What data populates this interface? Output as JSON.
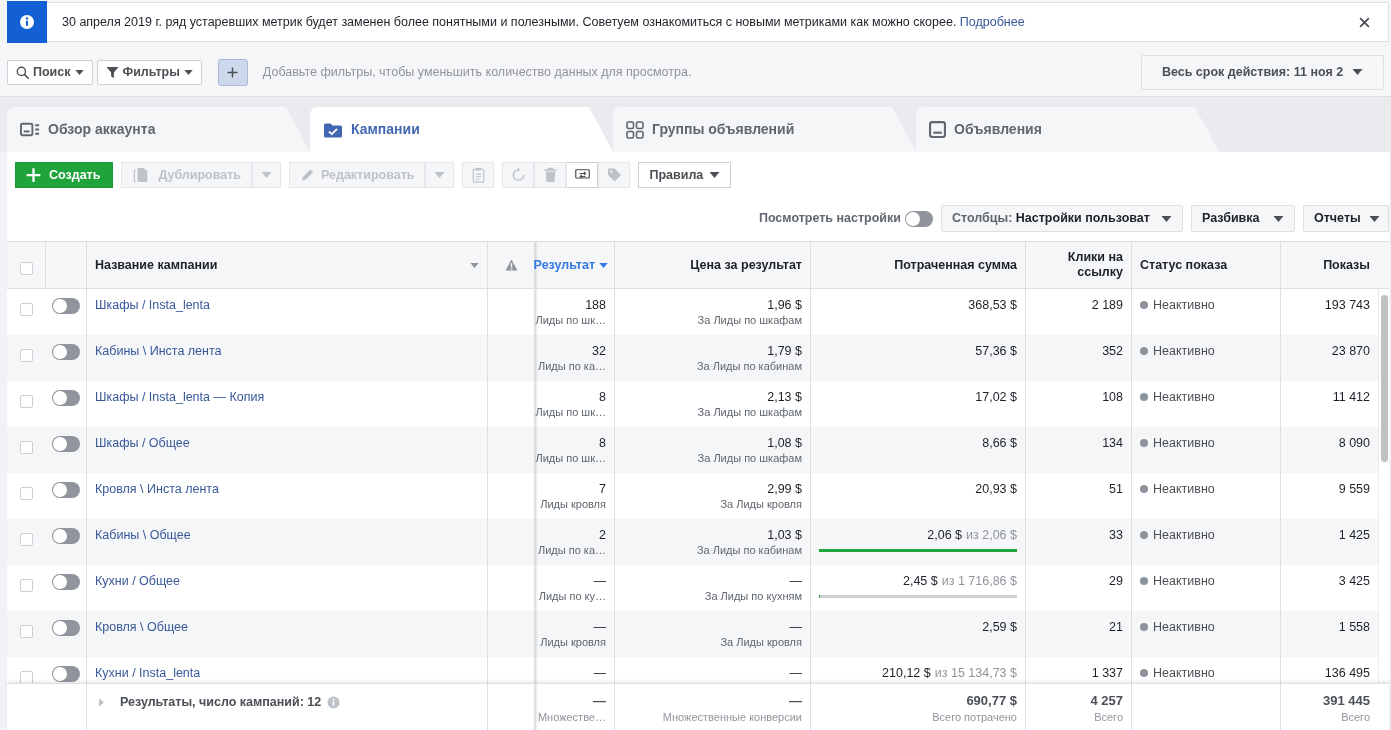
{
  "banner": {
    "text": "30 апреля 2019 г. ряд устаревших метрик будет заменен более понятными и полезными. Советуем ознакомиться с новыми метриками как можно скорее.",
    "link": "Подробнее"
  },
  "filter_bar": {
    "buttons": [
      {
        "kind": "search",
        "label": "Поиск"
      },
      {
        "kind": "filter",
        "label": "Фильтры"
      }
    ],
    "placeholder": "Добавьте фильтры, чтобы уменьшить количество данных для просмотра.",
    "date_range": "Весь срок действия: 11 ноя 2"
  },
  "tabs": [
    {
      "kind": "overview",
      "label": "Обзор аккаунта",
      "selected": false
    },
    {
      "kind": "campaigns",
      "label": "Кампании",
      "selected": true
    },
    {
      "kind": "adsets",
      "label": "Группы объявлений",
      "selected": false
    },
    {
      "kind": "ads",
      "label": "Объявления",
      "selected": false
    }
  ],
  "toolbar": {
    "groups": [
      [
        {
          "kind": "create",
          "label": "Создать",
          "disabled": false
        }
      ],
      [
        {
          "kind": "duplicate",
          "label": "Дублировать",
          "disabled": true,
          "split": true
        }
      ],
      [
        {
          "kind": "edit",
          "label": "Редактировать",
          "disabled": true,
          "split": true
        }
      ],
      [
        {
          "kind": "clipboard",
          "disabled": true
        }
      ],
      [
        {
          "kind": "refresh",
          "disabled": true
        },
        {
          "kind": "delete",
          "disabled": true
        },
        {
          "kind": "swap",
          "disabled": false
        },
        {
          "kind": "tag",
          "disabled": true
        }
      ],
      [
        {
          "kind": "rules",
          "label": "Правила",
          "disabled": false,
          "dropdown": true
        }
      ]
    ],
    "view_settings": {
      "label": "Посмотреть настройки",
      "on": false
    },
    "columns_button": {
      "prefix": "Столбцы:",
      "value": "Настройки пользоват"
    },
    "breakdown_button": "Разбивка",
    "reports_button": "Отчеты"
  },
  "table": {
    "select_all": {
      "checked": false
    },
    "columns": [
      {
        "label": "Название кампании",
        "sorted": false,
        "menu": true
      },
      {
        "kind": "warning"
      },
      {
        "label": "Результат",
        "sorted": true,
        "menu": true
      },
      {
        "label": "Цена за результат",
        "sorted": false
      },
      {
        "label": "Потраченная сумма",
        "sorted": false
      },
      {
        "label": "Клики на ссылку",
        "sorted": false
      },
      {
        "label": "Статус показа",
        "sorted": false
      },
      {
        "label": "Показы",
        "sorted": false
      }
    ],
    "rows": [
      {
        "checked": false,
        "on": false,
        "name": "Шкафы / Insta_lenta",
        "result": "188",
        "result_type": "Лиды по шк…",
        "cost": "1,96 $",
        "cost_type": "За Лиды по шкафам",
        "spent": "368,53 $",
        "clicks": "2 189",
        "status": {
          "text": "Неактивно",
          "color": "#8d949e"
        },
        "impressions": "193 743"
      },
      {
        "checked": false,
        "on": false,
        "name": "Кабины \\ Инста лента",
        "result": "32",
        "result_type": "Лиды по ка…",
        "cost": "1,79 $",
        "cost_type": "За Лиды по кабинам",
        "spent": "57,36 $",
        "clicks": "352",
        "status": {
          "text": "Неактивно",
          "color": "#8d949e"
        },
        "impressions": "23 870"
      },
      {
        "checked": false,
        "on": false,
        "name": "Шкафы / Insta_lenta — Копия",
        "result": "8",
        "result_type": "Лиды по шк…",
        "cost": "2,13 $",
        "cost_type": "За Лиды по шкафам",
        "spent": "17,02 $",
        "clicks": "108",
        "status": {
          "text": "Неактивно",
          "color": "#8d949e"
        },
        "impressions": "11 412"
      },
      {
        "checked": false,
        "on": false,
        "name": "Шкафы / Общее",
        "result": "8",
        "result_type": "Лиды по шк…",
        "cost": "1,08 $",
        "cost_type": "За Лиды по шкафам",
        "spent": "8,66 $",
        "clicks": "134",
        "status": {
          "text": "Неактивно",
          "color": "#8d949e"
        },
        "impressions": "8 090"
      },
      {
        "checked": false,
        "on": false,
        "name": "Кровля \\ Инста лента",
        "result": "7",
        "result_type": "Лиды кровля",
        "cost": "2,99 $",
        "cost_type": "За Лиды кровля",
        "spent": "20,93 $",
        "clicks": "51",
        "status": {
          "text": "Неактивно",
          "color": "#8d949e"
        },
        "impressions": "9 559"
      },
      {
        "checked": false,
        "on": false,
        "name": "Кабины \\ Общее",
        "result": "2",
        "result_type": "Лиды по ка…",
        "cost": "1,03 $",
        "cost_type": "За Лиды по кабинам",
        "spent": "2,06 $",
        "budget": {
          "of": "из 2,06 $",
          "level": 1
        },
        "clicks": "33",
        "status": {
          "text": "Неактивно",
          "color": "#8d949e"
        },
        "impressions": "1 425"
      },
      {
        "checked": false,
        "on": false,
        "name": "Кухни / Общее",
        "result": "—",
        "result_type": "Лиды по ку…",
        "cost": "—",
        "cost_type": "За Лиды по кухням",
        "spent": "2,45 $",
        "budget": {
          "of": "из 1 716,86 $",
          "level": 0
        },
        "clicks": "29",
        "status": {
          "text": "Неактивно",
          "color": "#8d949e"
        },
        "impressions": "3 425"
      },
      {
        "checked": false,
        "on": false,
        "name": "Кровля \\ Общее",
        "result": "—",
        "result_type": "Лиды кровля",
        "cost": "—",
        "cost_type": "За Лиды кровля",
        "spent": "2,59 $",
        "clicks": "21",
        "status": {
          "text": "Неактивно",
          "color": "#8d949e"
        },
        "impressions": "1 558"
      },
      {
        "checked": false,
        "on": false,
        "name": "Кухни / Insta_lenta",
        "result": "—",
        "cost": "—",
        "spent": "210,12 $",
        "budget": {
          "of": "из 15 134,73 $"
        },
        "clicks": "1 337",
        "status": {
          "text": "Неактивно",
          "color": "#8d949e"
        },
        "impressions": "136 495"
      }
    ],
    "summary": {
      "label": "Результаты, число кампаний: 12",
      "result": "—",
      "result_note": "Множестве…",
      "cost": "—",
      "cost_note": "Множественные конверсии",
      "spent": "690,77 $",
      "spent_note": "Всего потрачено",
      "clicks": "4 257",
      "clicks_note": "Всего",
      "impressions": "391 445",
      "impressions_note": "Всего"
    }
  }
}
